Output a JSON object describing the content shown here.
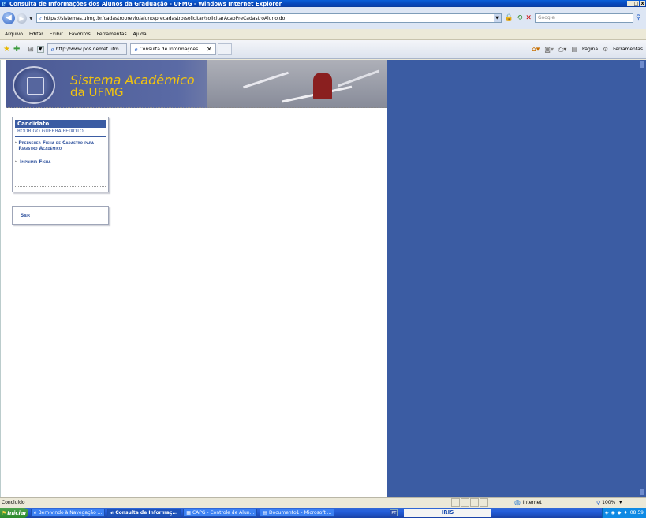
{
  "window": {
    "title": "Consulta de Informações dos Alunos da Graduação - UFMG - Windows Internet Explorer",
    "controls": [
      "_",
      "□",
      "x"
    ]
  },
  "address_bar": {
    "url": "https://sistemas.ufmg.br/cadastroprevio/aluno/precadastro/solicitar/solicitarAcaoPreCadastroAluno.do",
    "search_placeholder": "Google"
  },
  "menu": [
    "Arquivo",
    "Editar",
    "Exibir",
    "Favoritos",
    "Ferramentas",
    "Ajuda"
  ],
  "tabs": [
    {
      "label": "http://www.pos.demet.ufm...",
      "active": false
    },
    {
      "label": "Consulta de Informações...",
      "active": true
    }
  ],
  "command_bar": {
    "page_label": "Página",
    "tools_label": "Ferramentas"
  },
  "banner": {
    "title": "Sistema Acadêmico",
    "subtitle": "da UFMG"
  },
  "sidebar": {
    "header": "Candidato",
    "user": "RODRIGO GUERRA PEIXOTO",
    "items": [
      {
        "label": "Preencher Ficha de Cadastro para Registro Acadêmico"
      },
      {
        "label": "Imprimir Ficha"
      }
    ],
    "exit_label": "Sair"
  },
  "status_bar": {
    "text": "Concluído",
    "zone": "Internet",
    "zoom": "100%"
  },
  "taskbar": {
    "start_label": "Iniciar",
    "tasks": [
      {
        "label": "Bem-vindo à Navegação ...",
        "active": false
      },
      {
        "label": "Consulta de Informaç...",
        "active": true
      },
      {
        "label": "CAPG - Controle de Alun...",
        "active": false
      },
      {
        "label": "Documento1 - Microsoft ...",
        "active": false
      }
    ],
    "lang": "PT",
    "iris_label": "IRIS",
    "clock": "08:59"
  }
}
